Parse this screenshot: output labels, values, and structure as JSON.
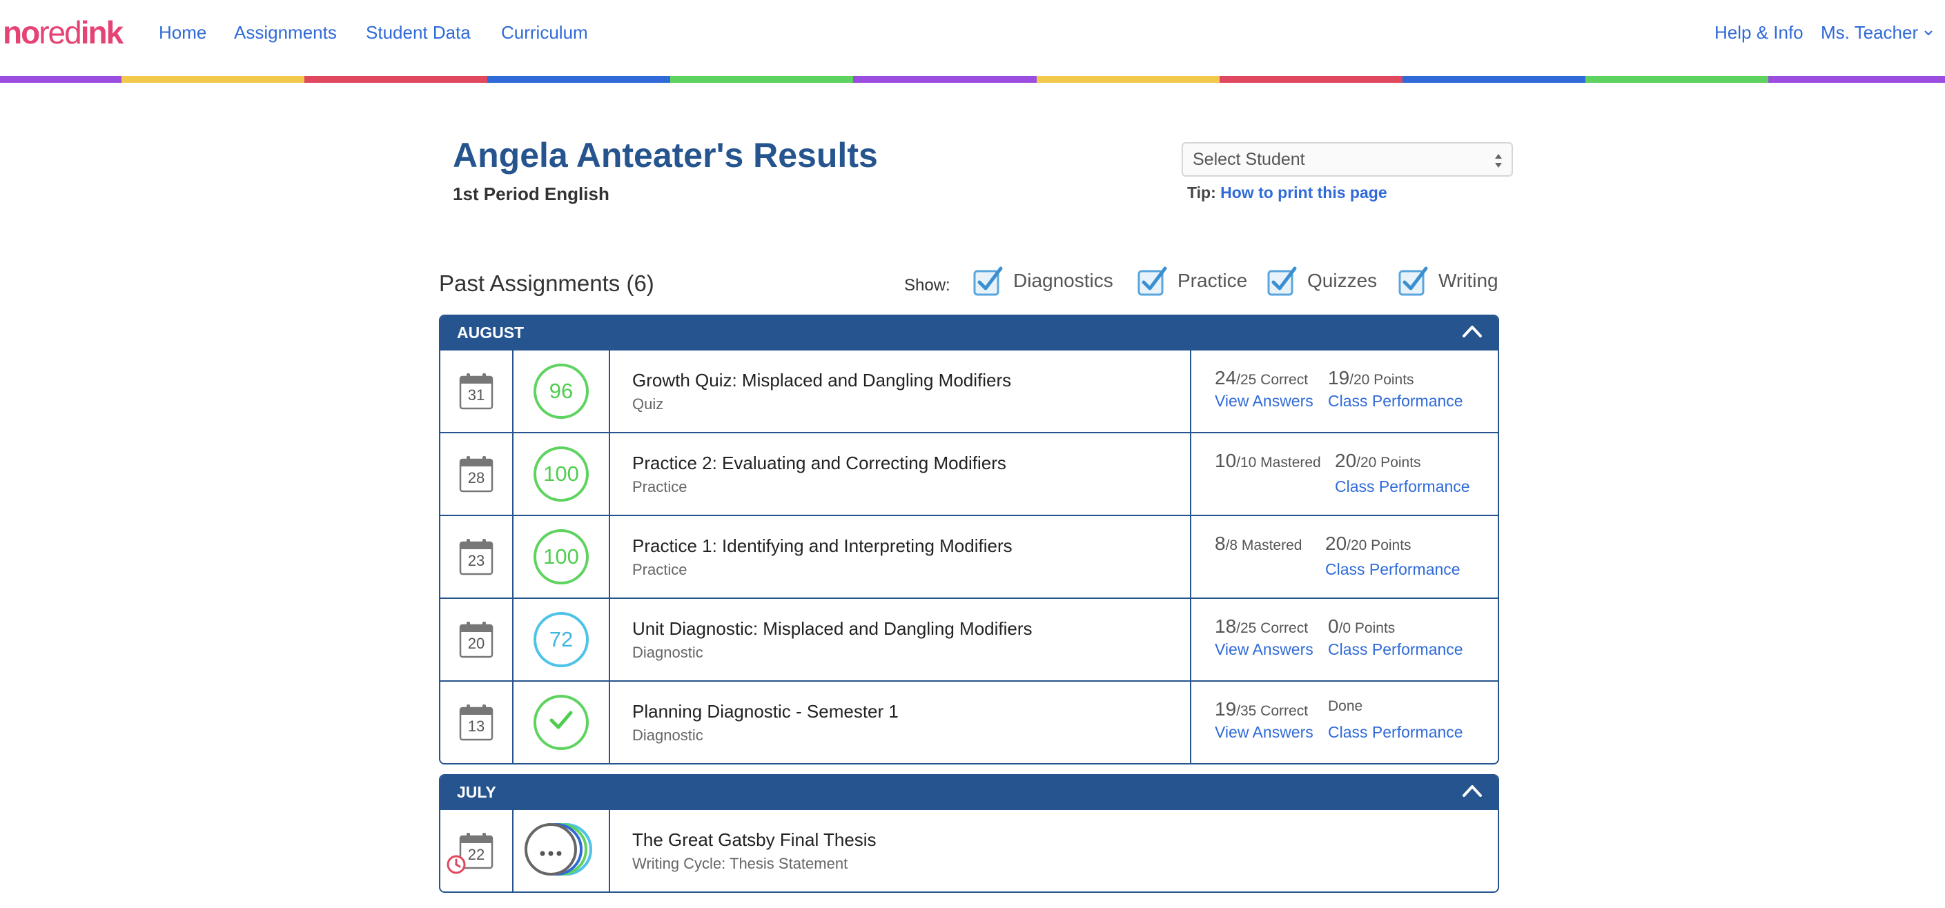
{
  "nav": {
    "logo": {
      "no": "no",
      "red": "red",
      "ink": "ink"
    },
    "links": [
      "Home",
      "Assignments",
      "Student Data",
      "Curriculum"
    ],
    "help": "Help & Info",
    "user": "Ms. Teacher",
    "stripe_colors": [
      "#9b4de0",
      "#f2c94c",
      "#e0485f",
      "#2f6ad8",
      "#5fd35f",
      "#9b4de0",
      "#f2c94c",
      "#e0485f",
      "#2f6ad8",
      "#5fd35f",
      "#9b4de0"
    ]
  },
  "header": {
    "title": "Angela Anteater's Results",
    "class_name": "1st Period English",
    "select_placeholder": "Select Student",
    "tip_label": "Tip:",
    "tip_link": "How to print this page"
  },
  "filters": {
    "title": "Past Assignments (6)",
    "show_label": "Show:",
    "items": [
      "Diagnostics",
      "Practice",
      "Quizzes",
      "Writing"
    ]
  },
  "months": [
    {
      "label": "AUGUST",
      "rows": [
        {
          "day": "31",
          "score": "96",
          "title": "Growth Quiz: Misplaced and Dangling Modifiers",
          "type": "Quiz",
          "stat1_num": "24",
          "stat1_rest": "/25 Correct",
          "stat2_num": "19",
          "stat2_rest": "/20 Points",
          "link1": "View Answers",
          "link2": "Class Performance"
        },
        {
          "day": "28",
          "score": "100",
          "title": "Practice 2: Evaluating and Correcting Modifiers",
          "type": "Practice",
          "stat1_num": "10",
          "stat1_rest": "/10 Mastered",
          "stat2_num": "20",
          "stat2_rest": "/20 Points",
          "link2": "Class Performance"
        },
        {
          "day": "23",
          "score": "100",
          "title": "Practice 1: Identifying and Interpreting Modifiers",
          "type": "Practice",
          "stat1_num": "8",
          "stat1_rest": "/8 Mastered",
          "stat2_num": "20",
          "stat2_rest": "/20 Points",
          "link2": "Class Performance"
        },
        {
          "day": "20",
          "score": "72",
          "title": "Unit Diagnostic: Misplaced and Dangling Modifiers",
          "type": "Diagnostic",
          "stat1_num": "18",
          "stat1_rest": "/25 Correct",
          "stat2_num": "0",
          "stat2_rest": "/0 Points",
          "link1": "View Answers",
          "link2": "Class Performance"
        },
        {
          "day": "13",
          "title": "Planning Diagnostic - Semester 1",
          "type": "Diagnostic",
          "stat1_num": "19",
          "stat1_rest": "/35 Correct",
          "stat2_rest": "Done",
          "link1": "View Answers",
          "link2": "Class Performance"
        }
      ]
    },
    {
      "label": "JULY",
      "rows": [
        {
          "day": "22",
          "title": "The Great Gatsby Final Thesis",
          "type": "Writing Cycle: Thesis Statement"
        }
      ]
    }
  ]
}
